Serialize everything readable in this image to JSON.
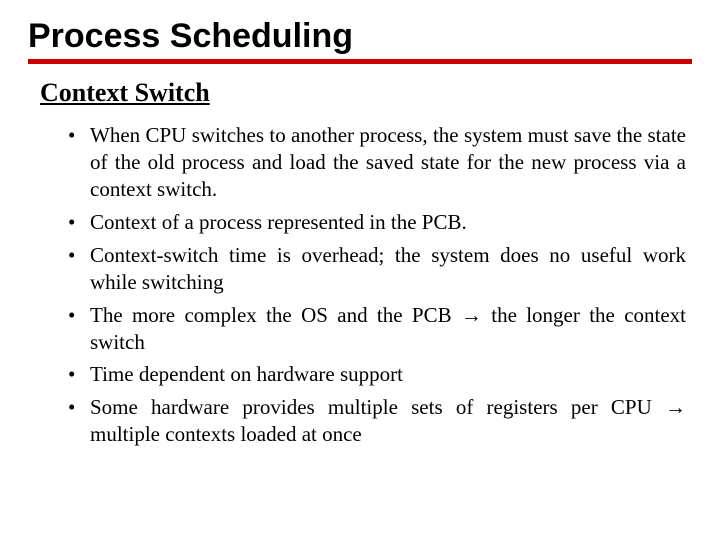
{
  "title": "Process Scheduling",
  "subtitle": "Context Switch",
  "arrow": "→",
  "bullets": [
    "When CPU switches to another process, the system must save the state of the old process and load the saved state for the new process via a context switch.",
    "Context of a process represented in the PCB.",
    "Context-switch time is overhead; the system does no useful work while switching",
    "The more complex the OS and the PCB → the longer the context switch",
    "Time dependent on hardware support",
    "Some hardware provides multiple sets of registers per CPU → multiple contexts loaded at once"
  ]
}
